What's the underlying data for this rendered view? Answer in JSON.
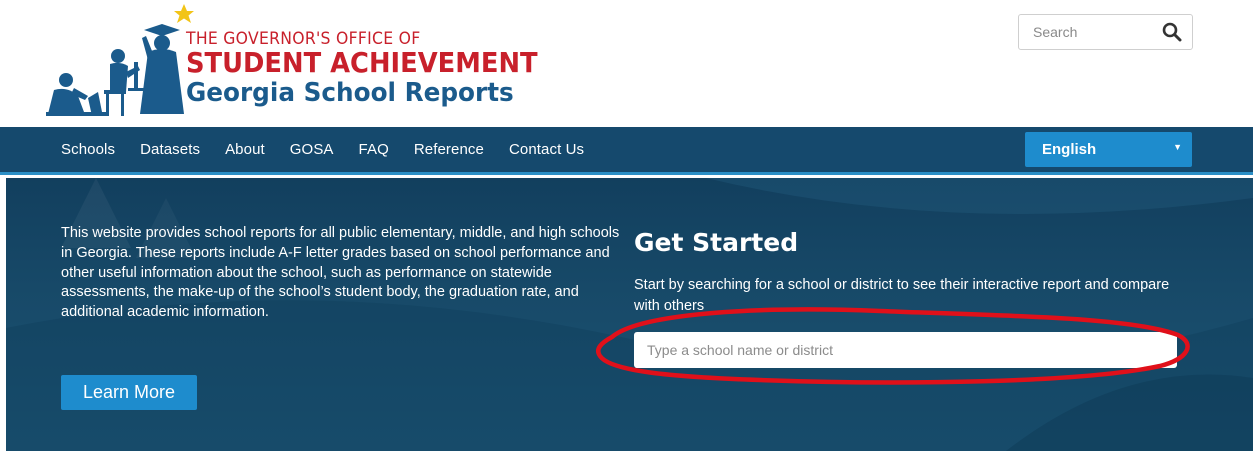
{
  "header": {
    "logo": {
      "line1": "THE GOVERNOR'S OFFICE OF",
      "line2": "STUDENT ACHIEVEMENT",
      "line3": "Georgia School Reports"
    },
    "search": {
      "placeholder": "Search",
      "value": "",
      "icon": "search-icon"
    }
  },
  "nav": {
    "items": [
      "Schools",
      "Datasets",
      "About",
      "GOSA",
      "FAQ",
      "Reference",
      "Contact Us"
    ],
    "language": {
      "selected": "English",
      "icon": "caret-down-icon"
    }
  },
  "hero": {
    "description": "This website provides school reports for all public elementary, middle, and high schools in Georgia. These reports include A-F letter grades based on school performance and other useful information about the school, such as performance on statewide assessments, the make-up of the school’s student body, the graduation rate, and additional academic information.",
    "learn_more": "Learn More",
    "get_started": {
      "title": "Get Started",
      "subtitle": "Start by searching for a school or district to see their interactive report and compare with others",
      "input_placeholder": "Type a school name or district",
      "input_value": ""
    }
  },
  "colors": {
    "brand_red": "#c8202b",
    "brand_blue": "#1b5b8c",
    "nav_bg": "#15496d",
    "accent": "#1e8ccd",
    "annotation_red": "#e0101a"
  }
}
